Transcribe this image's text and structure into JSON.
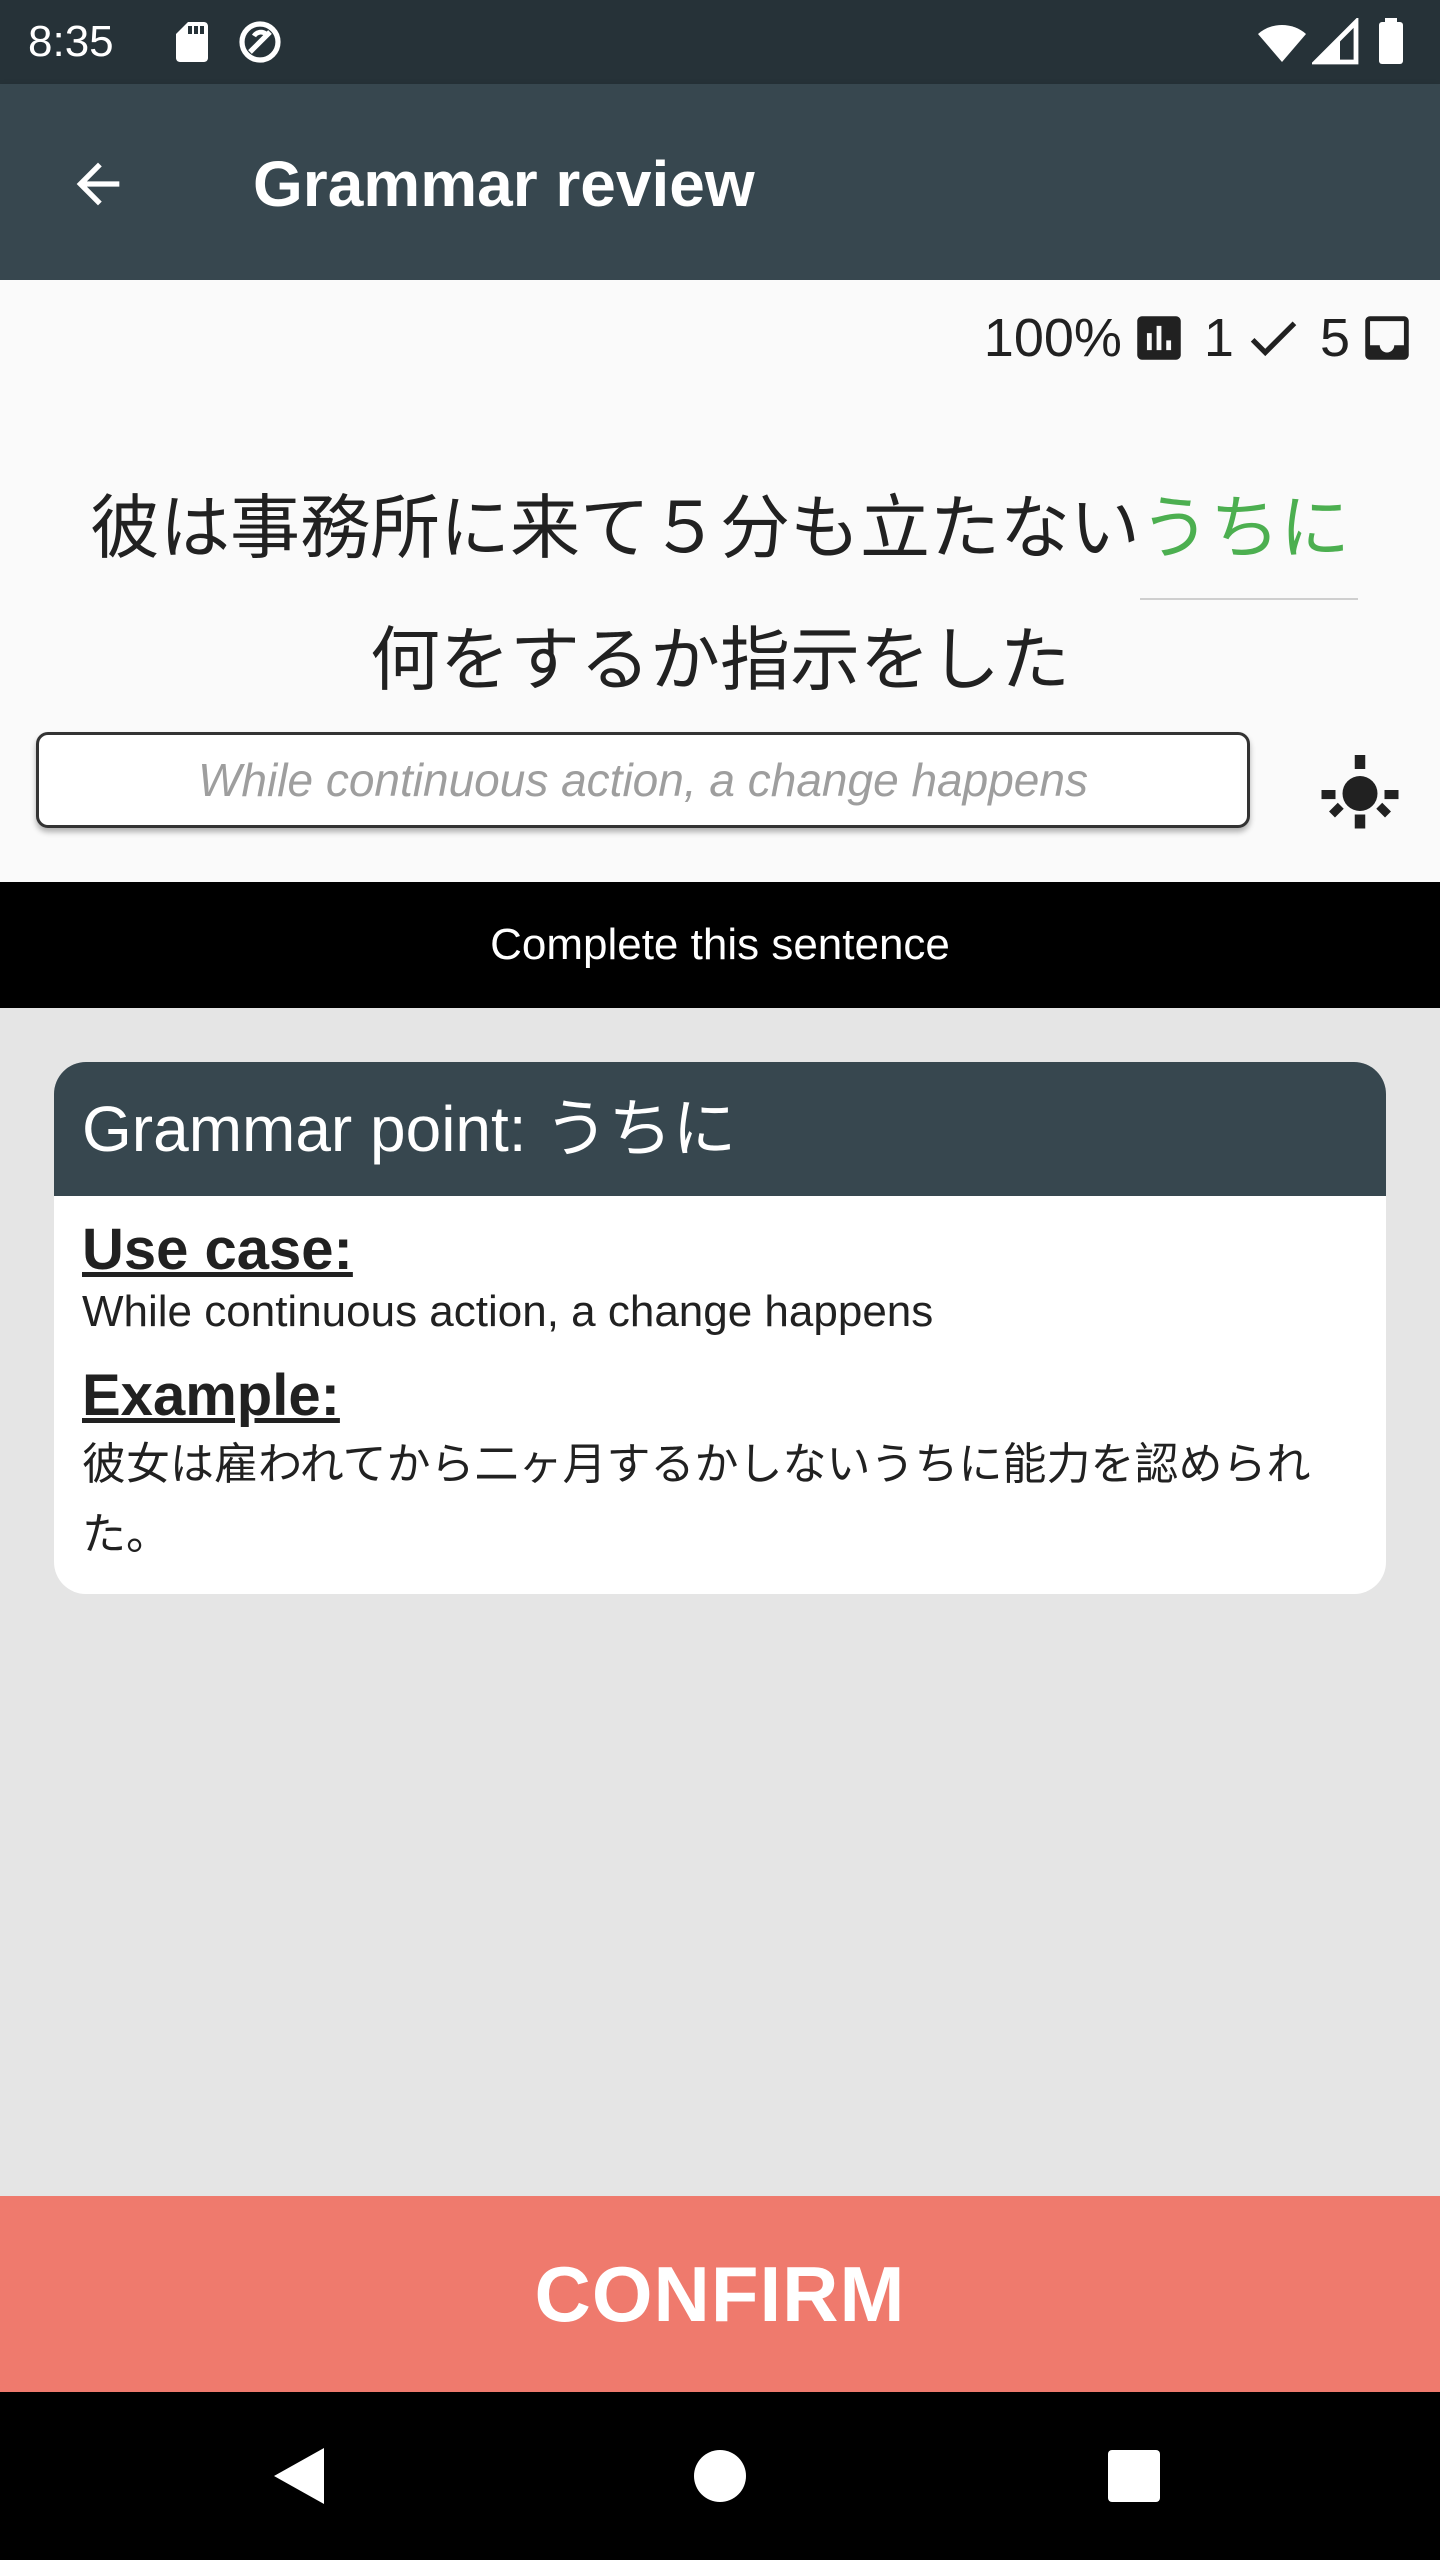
{
  "status_bar": {
    "time": "8:35",
    "icons": [
      "sd-card-icon",
      "sync-icon",
      "wifi-icon",
      "signal-icon",
      "battery-icon"
    ]
  },
  "app_bar": {
    "back_icon": "arrow-back-icon",
    "title": "Grammar review"
  },
  "stats": {
    "accuracy": "100%",
    "accuracy_icon": "bar-chart-icon",
    "correct_count": "1",
    "correct_icon": "check-icon",
    "remaining_count": "5",
    "remaining_icon": "inbox-icon"
  },
  "question": {
    "sentence_part1": "彼は事務所に来て５分も立たない",
    "answer": "うちに",
    "sentence_part2": "何をするか指示をした",
    "input_placeholder": "While continuous action, a change happens",
    "hint_icon": "lightbulb-icon"
  },
  "instruction": "Complete this sentence",
  "grammar_card": {
    "header_prefix": "Grammar point: ",
    "header_point": "うちに",
    "use_case_label": "Use case:",
    "use_case_text": "While continuous action, a change happens",
    "example_label": "Example:",
    "example_text": "彼女は雇われてから二ヶ月するかしないうちに能力を認められた。"
  },
  "confirm_label": "CONFIRM",
  "nav_bar": {
    "icons": [
      "nav-back-icon",
      "nav-home-icon",
      "nav-recents-icon"
    ]
  },
  "colors": {
    "app_bar": "#37474f",
    "status_bar": "#263238",
    "answer_text": "#4caf50",
    "confirm_button": "#ef7a6d",
    "instruction_bar": "#000000",
    "content_background": "#e5e5e5"
  }
}
